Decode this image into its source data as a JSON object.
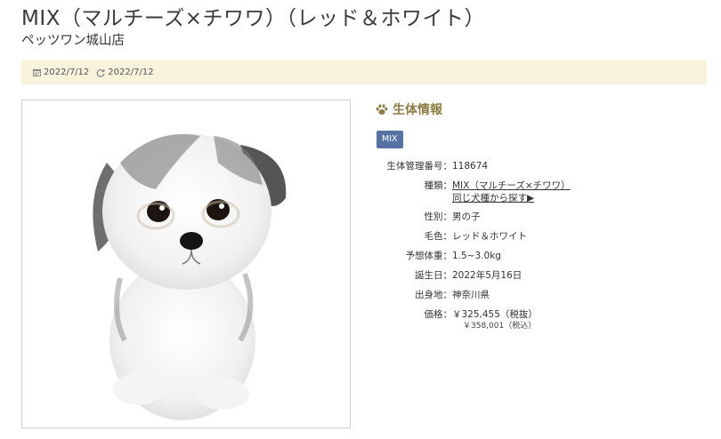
{
  "page": {
    "title": "MIX（マルチーズ×チワワ）（レッド＆ホワイト）",
    "shop": "ペッツワン城山店"
  },
  "dates": {
    "published": "2022/7/12",
    "updated": "2022/7/12"
  },
  "photo": {
    "alt": "puppy photo"
  },
  "section": {
    "title": "生体情報",
    "badge": "MIX"
  },
  "info": {
    "id_label": "生体管理番号：",
    "id_value": "118674",
    "breed_label": "種類：",
    "breed_link": "MIX（マルチーズ×チワワ）",
    "breed_search_link": "同じ犬種から探す▶",
    "sex_label": "性別：",
    "sex_value": "男の子",
    "color_label": "毛色：",
    "color_value": "レッド＆ホワイト",
    "weight_label": "予想体重：",
    "weight_value": "1.5~3.0kg",
    "birthday_label": "誕生日：",
    "birthday_value": "2022年5月16日",
    "origin_label": "出身地：",
    "origin_value": "神奈川県",
    "price_label": "価格：",
    "price_value": "￥325,455（税抜）",
    "price_tax_value": "￥358,001（税込）"
  },
  "colors": {
    "accent": "#8a7d46",
    "badge": "#5672a3",
    "datebar": "#f7f3dd"
  },
  "icons": {
    "published": "calendar-icon",
    "updated": "refresh-icon",
    "section": "paw-icon"
  }
}
